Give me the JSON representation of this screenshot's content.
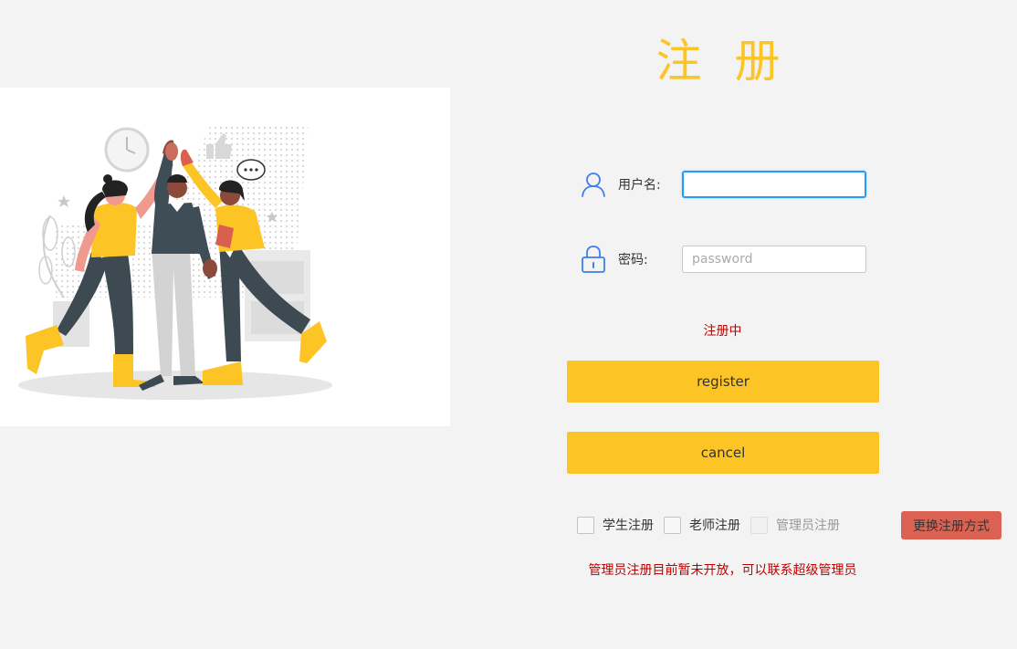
{
  "page": {
    "title": "注 册"
  },
  "illustration": {
    "icon": "team-high-five-illustration"
  },
  "form": {
    "username": {
      "label": "用户名:",
      "value": "",
      "placeholder": "",
      "icon": "user-icon"
    },
    "password": {
      "label": "密码:",
      "value": "",
      "placeholder": "password",
      "icon": "lock-icon"
    },
    "status_text": "注册中",
    "register_label": "register",
    "cancel_label": "cancel"
  },
  "roles": {
    "items": [
      {
        "label": "学生注册",
        "checked": false,
        "disabled": false
      },
      {
        "label": "老师注册",
        "checked": false,
        "disabled": false
      },
      {
        "label": "管理员注册",
        "checked": false,
        "disabled": true
      }
    ],
    "switch_label": "更换注册方式",
    "notice": "管理员注册目前暂未开放，可以联系超级管理员"
  },
  "colors": {
    "accent": "#fcc425",
    "danger": "#db6253",
    "error_text": "#c00000",
    "icon_blue": "#3f7ee8",
    "focus_blue": "#1e9fff",
    "background": "#f3f3f3"
  }
}
